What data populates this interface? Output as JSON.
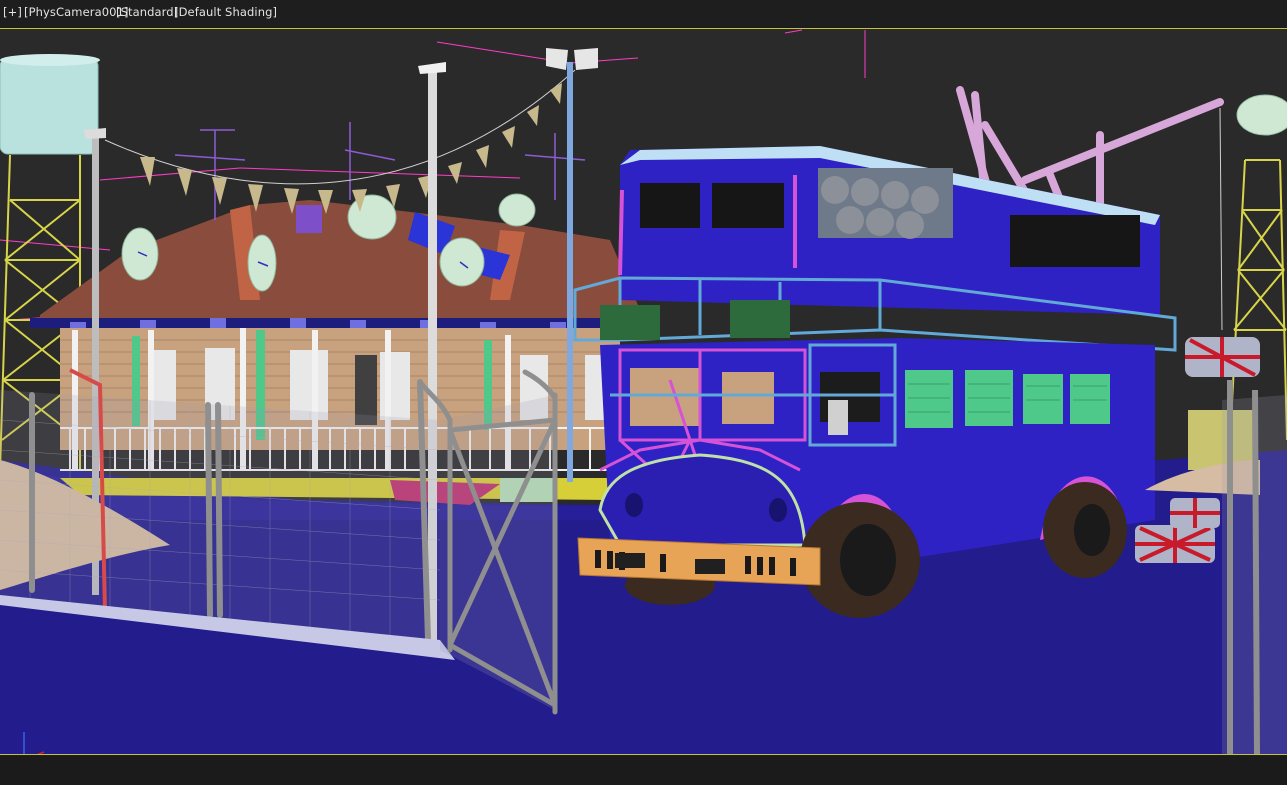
{
  "viewport": {
    "labels": {
      "plus": "[+]",
      "camera": "[PhysCamera001]",
      "mode": "[Standard]",
      "shading": "[Default Shading]"
    },
    "border_color": "#c6c23a"
  },
  "colors": {
    "background": "#2a2a2a",
    "ground": "#231c8c",
    "bus_body": "#2f22c4",
    "bus_trim": "#d652d6",
    "railing": "#63a9d8",
    "roof": "#8a4c3c",
    "house_wall": "#c8a27e",
    "shutter_green": "#4ec98a",
    "fence": "#8f8f8f",
    "bunting": "#c7b98c",
    "satellite_dish": "#cfe8d4",
    "water_tower": "#b9e2df",
    "crane": "#d8a7d9",
    "lattice_tower": "#d8d44a",
    "gizmo_lines": "#ff3cc8",
    "axis_x": "#d42020",
    "axis_y": "#27c02b",
    "axis_z": "#3b62e8"
  },
  "scene_objects": [
    "water-tower",
    "lattice-tower-left",
    "lattice-tower-right",
    "street-lamp",
    "flag-bunting",
    "satellite-dishes",
    "colonial-house",
    "veranda-railing",
    "chain-link-fence",
    "open-gate",
    "double-decker-bus",
    "crane-arm",
    "fuel-barrels",
    "sand-mound",
    "world-axis-tripod"
  ]
}
